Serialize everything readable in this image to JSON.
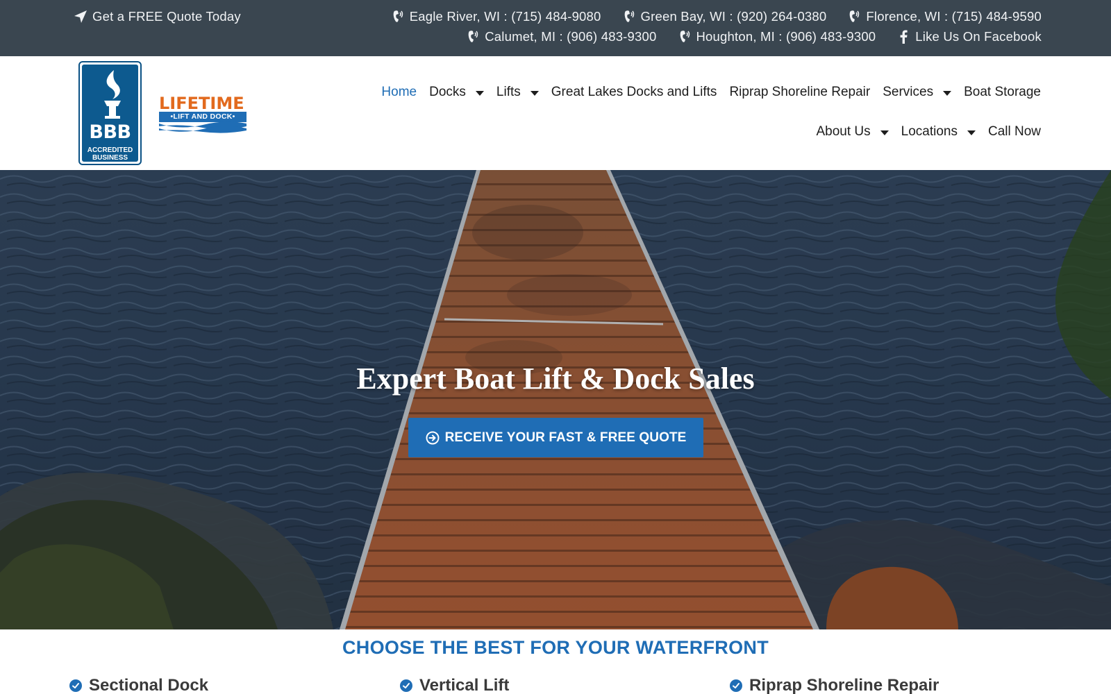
{
  "topbar": {
    "quote": "Get a FREE Quote Today",
    "phones_row1": [
      "Eagle River, WI : (715) 484-9080",
      "Green Bay, WI : (920) 264-0380",
      "Florence, WI : (715) 484-9590"
    ],
    "phones_row2": [
      "Calumet, MI : (906) 483-9300",
      "Houghton, MI : (906) 483-9300"
    ],
    "facebook": "Like Us On Facebook"
  },
  "logos": {
    "bbb_letters": "BBB",
    "bbb_sub_1": "ACCREDITED",
    "bbb_sub_2": "BUSINESS",
    "brand_word": "LIFETIME",
    "brand_band": "•LIFT AND DOCK•"
  },
  "nav": {
    "row1": [
      {
        "label": "Home",
        "active": true,
        "dropdown": false
      },
      {
        "label": "Docks",
        "dropdown": true
      },
      {
        "label": "Lifts",
        "dropdown": true
      },
      {
        "label": "Great Lakes Docks and Lifts",
        "dropdown": false
      },
      {
        "label": "Riprap Shoreline Repair",
        "dropdown": false
      },
      {
        "label": "Services",
        "dropdown": true
      },
      {
        "label": "Boat Storage",
        "dropdown": false
      }
    ],
    "row2": [
      {
        "label": "About Us",
        "dropdown": true
      },
      {
        "label": "Locations",
        "dropdown": true
      },
      {
        "label": "Call Now",
        "dropdown": false
      }
    ]
  },
  "hero": {
    "title": "Expert Boat Lift & Dock Sales",
    "cta": "RECEIVE YOUR FAST & FREE QUOTE"
  },
  "section": {
    "title": "CHOOSE THE BEST FOR YOUR WATERFRONT",
    "features": [
      "Sectional Dock",
      "Vertical Lift",
      "Riprap Shoreline Repair"
    ]
  },
  "colors": {
    "topbar_bg": "#3a4650",
    "accent_blue": "#1f6db5",
    "brand_orange": "#e26a1e",
    "bbb_blue": "#0d5a8f"
  }
}
